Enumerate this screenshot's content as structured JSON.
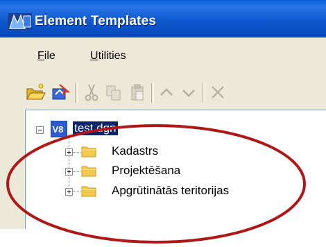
{
  "window": {
    "title": "Element Templates",
    "icon": "microstation-app-icon"
  },
  "menu": {
    "items": [
      {
        "label": "File",
        "accel": "F",
        "rest": "ile"
      },
      {
        "label": "Utilities",
        "accel": "U",
        "rest": "tilities"
      }
    ]
  },
  "toolbar": {
    "buttons": [
      {
        "name": "open-folder-icon",
        "enabled": true
      },
      {
        "name": "import-template-icon",
        "enabled": true
      },
      {
        "name": "cut-icon",
        "enabled": false
      },
      {
        "name": "copy-icon",
        "enabled": false
      },
      {
        "name": "paste-icon",
        "enabled": false
      },
      {
        "name": "move-up-icon",
        "enabled": false
      },
      {
        "name": "move-down-icon",
        "enabled": false
      },
      {
        "name": "delete-icon",
        "enabled": false
      }
    ]
  },
  "tree": {
    "root": {
      "label": "test.dgn",
      "icon": "v8-dgn-icon",
      "expanded": true,
      "selected": true
    },
    "children": [
      {
        "label": "Kadastrs",
        "icon": "folder-icon",
        "expanded": false
      },
      {
        "label": "Projektēšana",
        "icon": "folder-icon",
        "expanded": false
      },
      {
        "label": "Apgrūtinātās teritorijas",
        "icon": "folder-icon",
        "expanded": false
      }
    ]
  },
  "colors": {
    "titlebar": "#0d58d0",
    "selection": "#0a246a",
    "annotation": "#b01818",
    "folder": "#f2c94c"
  }
}
